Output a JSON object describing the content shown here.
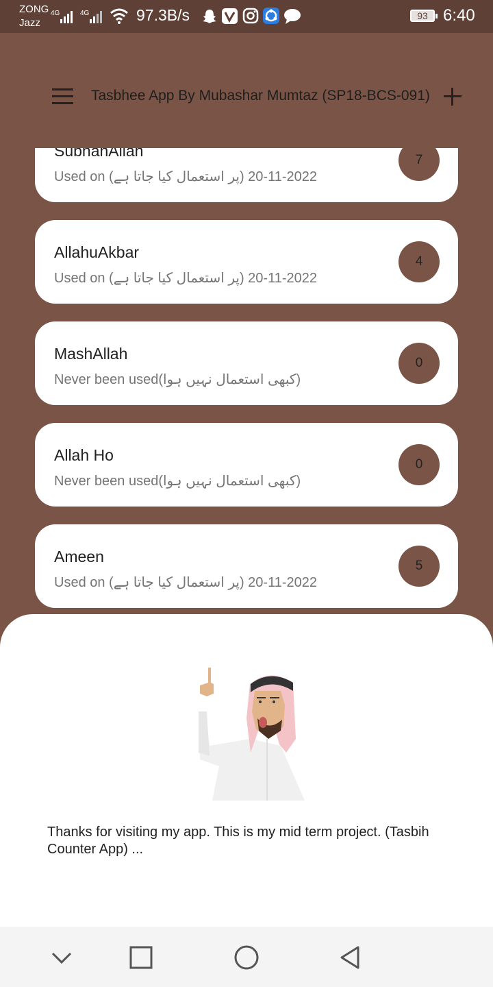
{
  "status_bar": {
    "carrier_top": "ZONG",
    "carrier_bottom": "Jazz",
    "net_speed": "97.3B/s",
    "battery": "93",
    "time": "6:40",
    "icons": [
      "signal-4g-icon",
      "signal-4g-icon",
      "wifi-icon",
      "snapchat-icon",
      "vpn-icon",
      "instagram-icon",
      "share-icon",
      "messages-icon"
    ]
  },
  "app_bar": {
    "title": "Tasbhee App By Mubashar Mumtaz (SP18-BCS-091)",
    "menu_icon": "hamburger-menu-icon",
    "add_icon": "plus-icon"
  },
  "items": [
    {
      "name": "SubhanAllah",
      "status": "Used on (پر استعمال کیا جاتا ہے) 2022-11-20",
      "count": "7"
    },
    {
      "name": "AllahuAkbar",
      "status": "Used on (پر استعمال کیا جاتا ہے) 2022-11-20",
      "count": "4"
    },
    {
      "name": "MashAllah",
      "status": "Never been used(کبھی استعمال نہیں ہوا)",
      "count": "0"
    },
    {
      "name": "Allah Ho",
      "status": "Never been used(کبھی استعمال نہیں ہوا)",
      "count": "0"
    },
    {
      "name": "Ameen",
      "status": "Used on (پر استعمال کیا جاتا ہے) 2022-11-20",
      "count": "5"
    }
  ],
  "sheet": {
    "message": "Thanks for visiting my app. This is my mid term project. (Tasbih Counter App) ...",
    "illustration": "man-pointing-up-illustration"
  },
  "nav_bar": {
    "icons": [
      "chevron-down-icon",
      "recents-square-icon",
      "home-circle-icon",
      "back-triangle-icon"
    ]
  },
  "colors": {
    "primary": "#7a5547",
    "status_bar": "#5e4036",
    "card": "#ffffff"
  }
}
